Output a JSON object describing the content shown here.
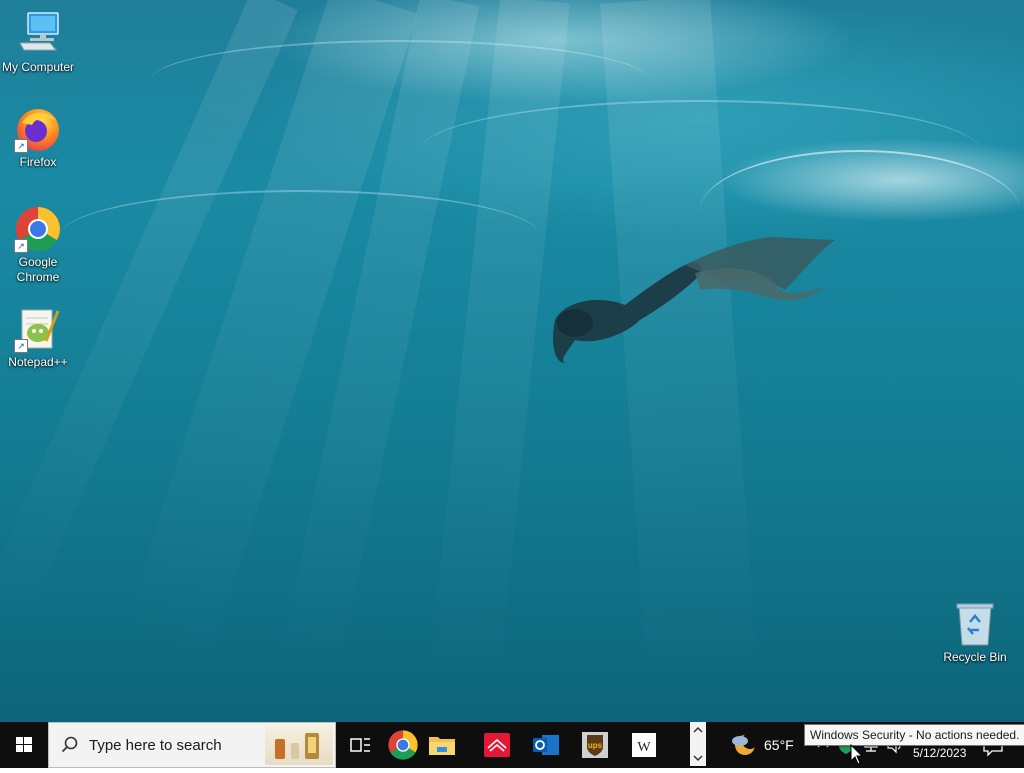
{
  "desktop": {
    "icons": [
      {
        "label": "My Computer"
      },
      {
        "label": "Firefox"
      },
      {
        "label": "Google Chrome"
      },
      {
        "label": "Notepad++"
      },
      {
        "label": "Recycle Bin"
      }
    ]
  },
  "taskbar": {
    "search_placeholder": "Type here to search",
    "apps": [
      "task-view",
      "google-chrome",
      "file-explorer",
      "bank-of-america",
      "outlook",
      "ups",
      "wikipedia"
    ],
    "weather": {
      "temp": "65°F"
    },
    "clock": {
      "date": "5/12/2023"
    },
    "tray_icons": [
      "show-hidden-icons",
      "windows-security",
      "network",
      "volume",
      "action-center"
    ]
  },
  "tooltip": {
    "text": "Windows Security - No actions needed."
  },
  "colors": {
    "taskbar_bg": "#0e0e0e",
    "search_bg": "#f3f3f3",
    "water_top": "#1f7f9a",
    "water_bottom": "#0d6579"
  }
}
